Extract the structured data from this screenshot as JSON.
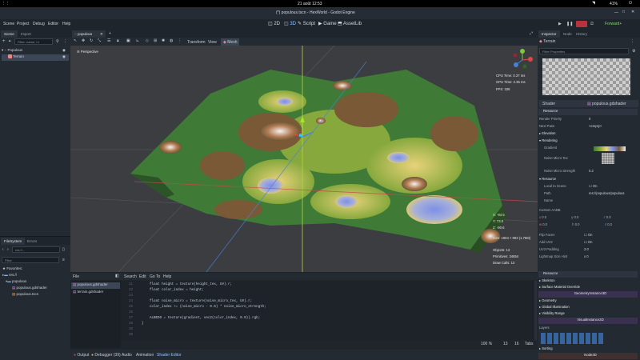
{
  "system": {
    "clock": "21 août 12:53",
    "battery": "41%"
  },
  "window": {
    "title": "(*) populous.tscn - HexWorld - Godot Engine",
    "right_label": "Forward+"
  },
  "menu": [
    "Scene",
    "Project",
    "Debug",
    "Editor",
    "Help"
  ],
  "workspaces": [
    "2D",
    "3D",
    "Script",
    "Game",
    "AssetLib"
  ],
  "scene_dock": {
    "tabs": [
      "Scene",
      "Import"
    ],
    "filter_placeholder": "Filter: name, t:t",
    "nodes": [
      "Populous",
      "Terrain"
    ]
  },
  "filesystem": {
    "tabs": [
      "FileSystem",
      "Errors"
    ],
    "path": "res://...",
    "filter_placeholder": "Filter",
    "items": [
      "Favorites:",
      "res://",
      "populous",
      "populous.gdshader",
      "populous.tscn"
    ]
  },
  "scene_tabs": [
    "populous"
  ],
  "viewport_toolbar": {
    "menus": [
      "Transform",
      "View"
    ],
    "mode": "Mesh"
  },
  "viewport": {
    "label": "Perspective",
    "stats": [
      "CPU Time: 0.37 ms",
      "GPU Time: 2.35 ms",
      "FPS: 336"
    ],
    "gizmo_readout": [
      "X: -84.5",
      "Y: 73.0",
      "Z: -90.6"
    ],
    "size": "Size: 1904 × 993 (1.76M)",
    "objects": "Objects: 13",
    "primitives": "Primitives: 34654",
    "draw_calls": "Draw Calls: 13"
  },
  "script_editor": {
    "menus": [
      "File",
      "Search",
      "Edit",
      "Go To",
      "Help"
    ],
    "files": [
      "populous.gdshader",
      "terrain.gdshader"
    ],
    "line_numbers": [
      "21",
      "22",
      "23",
      "24",
      "25",
      "26",
      "27",
      "28",
      "29",
      "30",
      "31"
    ],
    "lines": [
      "float height = texture(height_tex, UV).r;",
      "float color_index = height;",
      "",
      "float noise_micro = texture(noise_micro_tex, UV).r;",
      "color_index += (noise_micro - 0.5) * noise_micro_strength;",
      "",
      "ALBEDO = texture(gradient, vec2(color_index, 0.0)).rgb;",
      "}",
      "",
      "",
      ""
    ],
    "status": {
      "zoom": "100 %",
      "line": "13",
      "col": "16",
      "indent": "Tabs"
    }
  },
  "bottom_tabs": [
    "Output",
    "Debugger (39)",
    "Audio",
    "Animation",
    "Shader Editor"
  ],
  "inspector": {
    "tabs": [
      "Inspector",
      "Node",
      "History"
    ],
    "node": "Terrain",
    "filter_placeholder": "Filter Properties",
    "shader_label": "Shader",
    "shader_value": "populous.gdshader",
    "sections": {
      "resource": "Resource",
      "render_priority": "Render Priority",
      "render_priority_value": "0",
      "next_pass": "Next Pass",
      "next_pass_value": "<empty>",
      "elevation": "Elevation",
      "rendering": "Rendering",
      "gradient": "Gradient",
      "noise_micro_tex": "Noise Micro Tex",
      "noise_micro_strength": "Noise Micro Strength",
      "noise_micro_strength_value": "0.2",
      "resource2": "Resource",
      "local_to_scene": "Local to Scene",
      "local_to_scene_value": "On",
      "path": "Path",
      "path_value": "res://populous/populous",
      "name": "Name",
      "custom_aabb": "Custom AABB",
      "flip_faces": "Flip Faces",
      "flip_faces_value": "On",
      "add_uv2": "Add UV2",
      "add_uv2_value": "On",
      "uv2_padding": "UV2 Padding",
      "uv2_padding_value": "2.0",
      "lightmap": "Lightmap Size Hint",
      "resource3": "Resource",
      "skeleton": "Skeleton",
      "surface_material_override": "Surface Material Override",
      "geometry_instance": "GeometryInstance3D",
      "geometry": "Geometry",
      "global_illumination": "Global Illumination",
      "visibility_range": "Visibility Range",
      "visual_instance": "VisualInstance3D",
      "layers": "Layers",
      "sorting": "Sorting",
      "node3d": "Node3D"
    }
  }
}
